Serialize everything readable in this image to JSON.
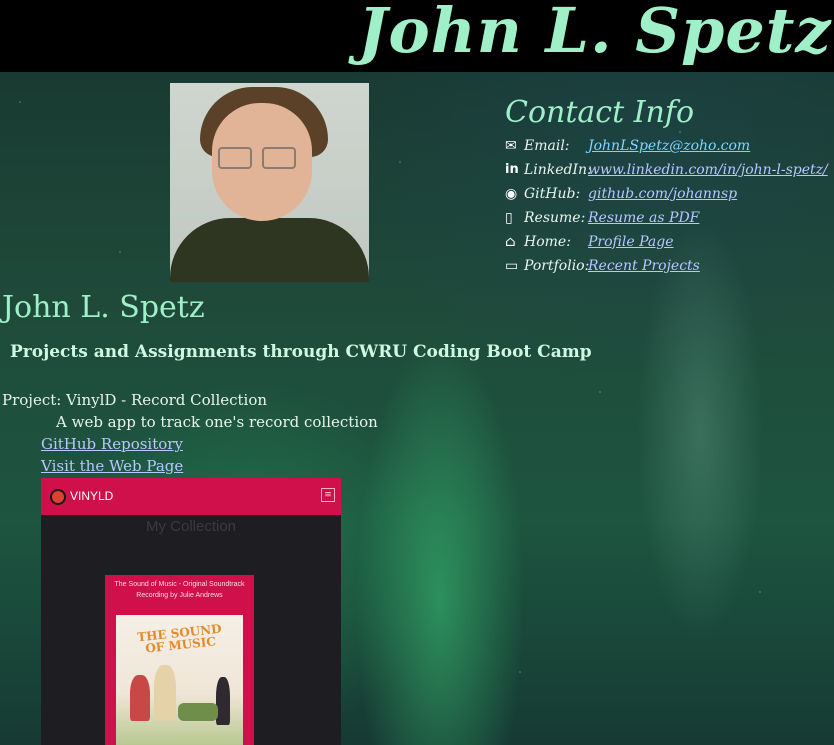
{
  "header": {
    "banner_name": "John L. Spetz"
  },
  "contact": {
    "title": "Contact Info",
    "rows": [
      {
        "icon": "envelope-icon",
        "label": "Email:",
        "value": "JohnLSpetz@zoho.com"
      },
      {
        "icon": "linkedin-icon",
        "label": "LinkedIn:",
        "value": "www.linkedin.com/in/john-l-spetz/"
      },
      {
        "icon": "github-icon",
        "label": "GitHub:",
        "value": "github.com/johannsp"
      },
      {
        "icon": "pdf-icon",
        "label": "Resume:",
        "value": "Resume as PDF"
      },
      {
        "icon": "home-icon",
        "label": "Home:",
        "value": "Profile Page"
      },
      {
        "icon": "monitor-icon",
        "label": "Portfolio:",
        "value": "Recent Projects"
      }
    ]
  },
  "profile": {
    "name": "John L. Spetz",
    "subtitle": "Projects and Assignments through CWRU Coding Boot Camp"
  },
  "project": {
    "title": "Project: VinylD - Record Collection",
    "description": "A web app to track one's record collection",
    "repo_link": "GitHub Repository",
    "site_link": "Visit the Web Page",
    "screenshot": {
      "brand": "VINYLD",
      "heading": "My Collection",
      "card_line1": "The Sound of Music - Original Soundtrack",
      "card_line2": "Recording by Julie Andrews",
      "album_title": "THE SOUND OF MUSIC"
    }
  }
}
